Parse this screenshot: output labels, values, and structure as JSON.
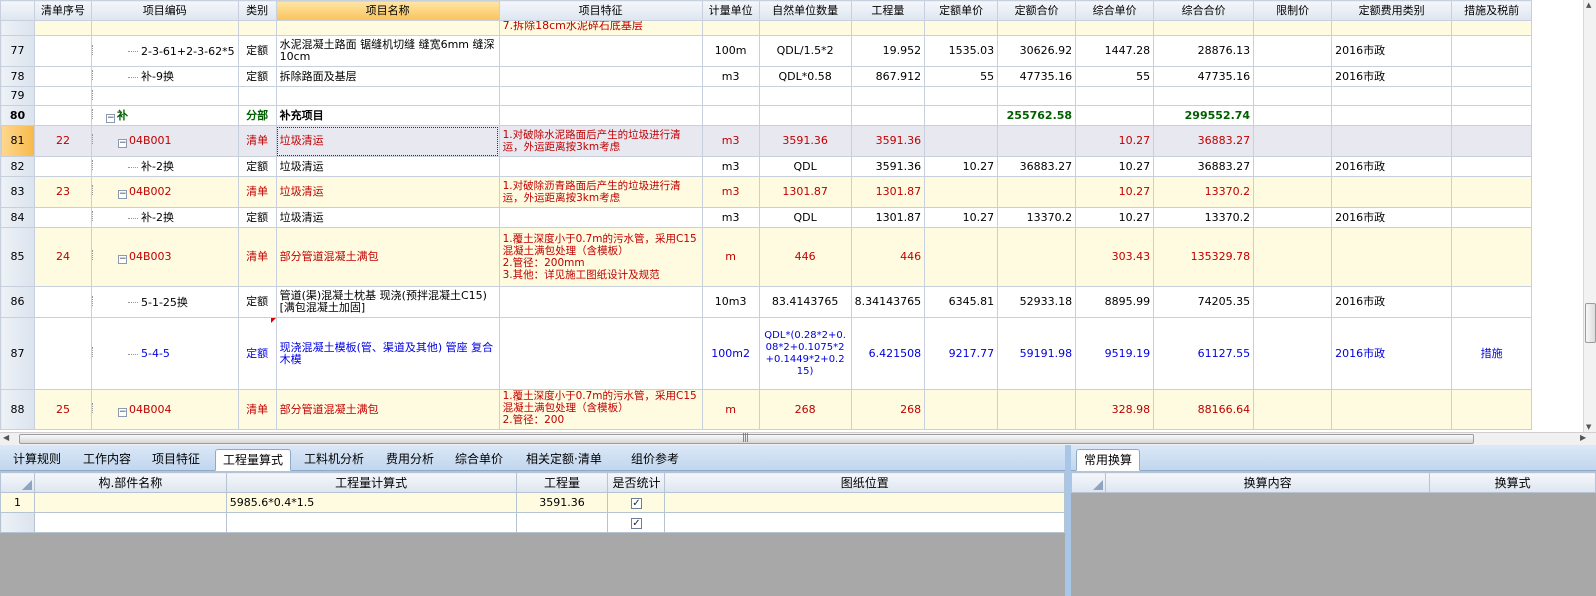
{
  "columns": [
    "",
    "清单序号",
    "项目编码",
    "类别",
    "项目名称",
    "项目特征",
    "计量单位",
    "自然单位数量",
    "工程量",
    "定额单价",
    "定额合价",
    "综合单价",
    "综合合价",
    "限制价",
    "定额费用类别",
    "措施及税前"
  ],
  "top_partial": {
    "feature": "7.拆除18cm水泥碎石底基层"
  },
  "rows": [
    {
      "rn": "77",
      "seq": "",
      "code": "2-3-61+2-3-62*5",
      "type": "定额",
      "name": "水泥混凝土路面 锯缝机切缝 缝宽6mm 缝深10cm",
      "feature": "",
      "unit": "100m",
      "natural": "QDL/1.5*2",
      "qty": "19.952",
      "q_price": "1535.03",
      "q_total": "30626.92",
      "c_price": "1447.28",
      "c_total": "28876.13",
      "limit": "",
      "fee": "2016市政",
      "measure": ""
    },
    {
      "rn": "78",
      "seq": "",
      "code": "补-9换",
      "type": "定额",
      "name": "拆除路面及基层",
      "feature": "",
      "unit": "m3",
      "natural": "QDL*0.58",
      "qty": "867.912",
      "q_price": "55",
      "q_total": "47735.16",
      "c_price": "55",
      "c_total": "47735.16",
      "limit": "",
      "fee": "2016市政",
      "measure": ""
    },
    {
      "rn": "79",
      "seq": "",
      "code": "",
      "type": "",
      "name": "",
      "feature": "",
      "unit": "",
      "natural": "",
      "qty": "",
      "q_price": "",
      "q_total": "",
      "c_price": "",
      "c_total": "",
      "limit": "",
      "fee": "",
      "measure": ""
    },
    {
      "rn": "80",
      "seq": "",
      "code": "补",
      "type": "分部",
      "name": "补充项目",
      "feature": "",
      "unit": "",
      "natural": "",
      "qty": "",
      "q_price": "",
      "q_total": "255762.58",
      "c_price": "",
      "c_total": "299552.74",
      "limit": "",
      "fee": "",
      "measure": ""
    },
    {
      "rn": "81",
      "seq": "22",
      "code": "04B001",
      "type": "清单",
      "name": "垃圾清运",
      "feature": "1.对破除水泥路面后产生的垃圾进行清运，外运距离按3km考虑",
      "unit": "m3",
      "natural": "3591.36",
      "qty": "3591.36",
      "q_price": "",
      "q_total": "",
      "c_price": "10.27",
      "c_total": "36883.27",
      "limit": "",
      "fee": "",
      "measure": ""
    },
    {
      "rn": "82",
      "seq": "",
      "code": "补-2换",
      "type": "定额",
      "name": "垃圾清运",
      "feature": "",
      "unit": "m3",
      "natural": "QDL",
      "qty": "3591.36",
      "q_price": "10.27",
      "q_total": "36883.27",
      "c_price": "10.27",
      "c_total": "36883.27",
      "limit": "",
      "fee": "2016市政",
      "measure": ""
    },
    {
      "rn": "83",
      "seq": "23",
      "code": "04B002",
      "type": "清单",
      "name": "垃圾清运",
      "feature": "1.对破除沥青路面后产生的垃圾进行清运，外运距离按3km考虑",
      "unit": "m3",
      "natural": "1301.87",
      "qty": "1301.87",
      "q_price": "",
      "q_total": "",
      "c_price": "10.27",
      "c_total": "13370.2",
      "limit": "",
      "fee": "",
      "measure": ""
    },
    {
      "rn": "84",
      "seq": "",
      "code": "补-2换",
      "type": "定额",
      "name": "垃圾清运",
      "feature": "",
      "unit": "m3",
      "natural": "QDL",
      "qty": "1301.87",
      "q_price": "10.27",
      "q_total": "13370.2",
      "c_price": "10.27",
      "c_total": "13370.2",
      "limit": "",
      "fee": "2016市政",
      "measure": ""
    },
    {
      "rn": "85",
      "seq": "24",
      "code": "04B003",
      "type": "清单",
      "name": "部分管道混凝土满包",
      "feature": "1.覆土深度小于0.7m的污水管，采用C15混凝土满包处理（含模板）\n2.管径：200mm\n3.其他：详见施工图纸设计及规范",
      "unit": "m",
      "natural": "446",
      "qty": "446",
      "q_price": "",
      "q_total": "",
      "c_price": "303.43",
      "c_total": "135329.78",
      "limit": "",
      "fee": "",
      "measure": ""
    },
    {
      "rn": "86",
      "seq": "",
      "code": "5-1-25换",
      "type": "定额",
      "name": "管道(渠)混凝土枕基 现浇(预拌混凝土C15)[满包混凝土加固]",
      "feature": "",
      "unit": "10m3",
      "natural": "83.4143765",
      "qty": "8.34143765",
      "q_price": "6345.81",
      "q_total": "52933.18",
      "c_price": "8895.99",
      "c_total": "74205.35",
      "limit": "",
      "fee": "2016市政",
      "measure": ""
    },
    {
      "rn": "87",
      "seq": "",
      "code": "5-4-5",
      "type": "定额",
      "name": "现浇混凝土模板(管、渠道及其他) 管座 复合木模",
      "feature": "",
      "unit": "100m2",
      "natural": "QDL*(0.28*2+0.08*2+0.1075*2+0.1449*2+0.215)",
      "qty": "6.421508",
      "q_price": "9217.77",
      "q_total": "59191.98",
      "c_price": "9519.19",
      "c_total": "61127.55",
      "limit": "",
      "fee": "2016市政",
      "measure": "措施"
    },
    {
      "rn": "88",
      "seq": "25",
      "code": "04B004",
      "type": "清单",
      "name": "部分管道混凝土满包",
      "feature": "1.覆土深度小于0.7m的污水管，采用C15混凝土满包处理（含模板）\n2.管径：200",
      "unit": "m",
      "natural": "268",
      "qty": "268",
      "q_price": "",
      "q_total": "",
      "c_price": "328.98",
      "c_total": "88166.64",
      "limit": "",
      "fee": "",
      "measure": ""
    }
  ],
  "bottom_tabs": [
    "计算规则",
    "工作内容",
    "项目特征",
    "工程量算式",
    "工料机分析",
    "费用分析",
    "综合单价",
    "相关定额·清单",
    "组价参考"
  ],
  "bottom_active_tab": "工程量算式",
  "calc_grid": {
    "headers": [
      "构.部件名称",
      "工程量计算式",
      "工程量",
      "是否统计",
      "图纸位置"
    ],
    "rows": [
      {
        "rn": "1",
        "part": "",
        "formula": "5985.6*0.4*1.5",
        "qty": "3591.36",
        "counted": "✓",
        "pos": ""
      },
      {
        "rn": "",
        "part": "",
        "formula": "",
        "qty": "",
        "counted": "✓",
        "pos": ""
      }
    ]
  },
  "right_tabs": [
    "常用换算"
  ],
  "conv_grid": {
    "headers": [
      "换算内容",
      "换算式"
    ]
  },
  "colors": {
    "bill_red": "#c00000",
    "quota_blue": "#0000e0",
    "fenbu_green": "#006000",
    "yellow_row": "#fffbe0",
    "selected_row": "#e8e8f1"
  }
}
